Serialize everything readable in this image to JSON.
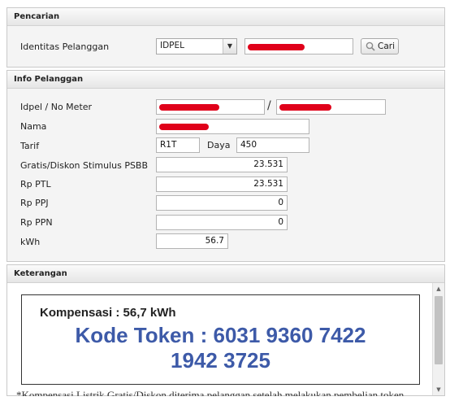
{
  "search": {
    "header": "Pencarian",
    "label": "Identitas Pelanggan",
    "select_value": "IDPEL",
    "button_label": "Cari"
  },
  "info": {
    "header": "Info Pelanggan",
    "idpel_label": "Idpel / No Meter",
    "separator": "/",
    "nama_label": "Nama",
    "tarif_label": "Tarif",
    "tarif_value": "R1T",
    "daya_label": "Daya",
    "daya_value": "450",
    "gratis_label": "Gratis/Diskon Stimulus PSBB",
    "gratis_value": "23.531",
    "ptl_label": "Rp PTL",
    "ptl_value": "23.531",
    "ppj_label": "Rp PPJ",
    "ppj_value": "0",
    "ppn_label": "Rp PPN",
    "ppn_value": "0",
    "kwh_label": "kWh",
    "kwh_value": "56.7"
  },
  "note": {
    "header": "Keterangan",
    "kompensasi": "Kompensasi : 56,7 kWh",
    "token_line1": "Kode Token : 6031 9360 7422",
    "token_line2": "1942 3725",
    "footer_text": "*Kompensasi Listrik Gratis/Diskon diterima pelanggan setelah melakukan pembelian token"
  },
  "colors": {
    "token_blue": "#3d5aa8",
    "redaction_red": "#e0001a"
  }
}
